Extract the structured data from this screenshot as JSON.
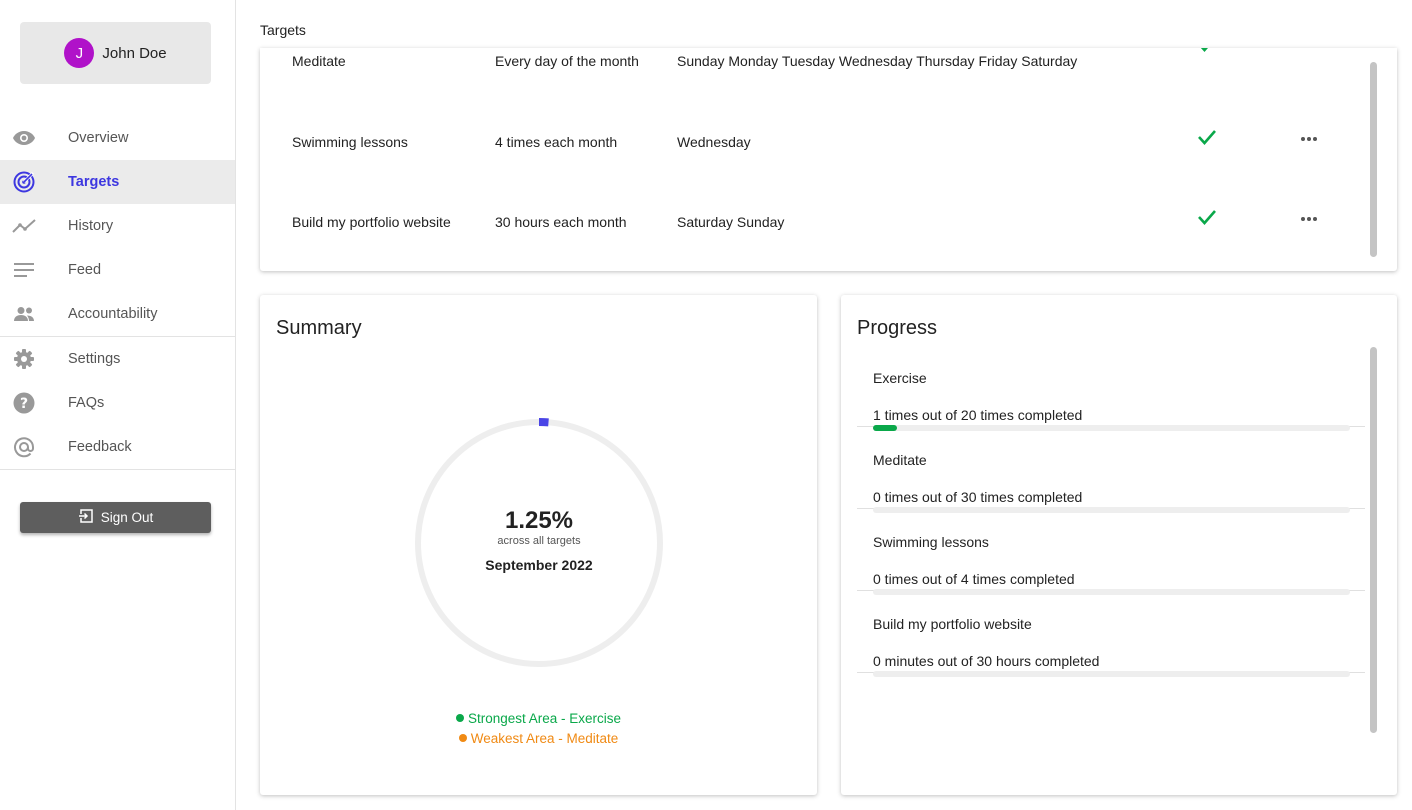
{
  "user": {
    "initial": "J",
    "name": "John Doe"
  },
  "nav": [
    {
      "label": "Overview",
      "icon": "eye-icon",
      "active": false
    },
    {
      "label": "Targets",
      "icon": "target-icon",
      "active": true
    },
    {
      "label": "History",
      "icon": "trend-icon",
      "active": false
    },
    {
      "label": "Feed",
      "icon": "lines-icon",
      "active": false
    },
    {
      "label": "Accountability",
      "icon": "people-icon",
      "active": false
    },
    {
      "label": "Settings",
      "icon": "gear-icon",
      "active": false
    },
    {
      "label": "FAQs",
      "icon": "help-icon",
      "active": false
    },
    {
      "label": "Feedback",
      "icon": "at-icon",
      "active": false
    }
  ],
  "signout_label": "Sign Out",
  "page_title": "Targets",
  "targets": [
    {
      "name": "Meditate",
      "frequency": "Every day of the month",
      "days": "Sunday Monday Tuesday Wednesday Thursday Friday Saturday",
      "active": true
    },
    {
      "name": "Swimming lessons",
      "frequency": "4 times each month",
      "days": "Wednesday",
      "active": true
    },
    {
      "name": "Build my portfolio website",
      "frequency": "30 hours each month",
      "days": "Saturday Sunday",
      "active": true
    }
  ],
  "summary": {
    "title": "Summary",
    "percent_label": "1.25%",
    "percent_value": 1.25,
    "percent_sub": "across all targets",
    "month": "September 2022",
    "strongest": "Strongest Area - Exercise",
    "weakest": "Weakest Area - Meditate"
  },
  "progress": {
    "title": "Progress",
    "items": [
      {
        "name": "Exercise",
        "text": "1 times out of 20 times completed",
        "fraction": 0.05
      },
      {
        "name": "Meditate",
        "text": "0 times out of 30 times completed",
        "fraction": 0
      },
      {
        "name": "Swimming lessons",
        "text": "0 times out of 4 times completed",
        "fraction": 0
      },
      {
        "name": "Build my portfolio website",
        "text": "0 minutes out of 30 hours completed",
        "fraction": 0
      }
    ]
  },
  "colors": {
    "accent": "#3d37e0",
    "avatar": "#b012c9",
    "success": "#0aa84a",
    "warning": "#f08a14"
  }
}
